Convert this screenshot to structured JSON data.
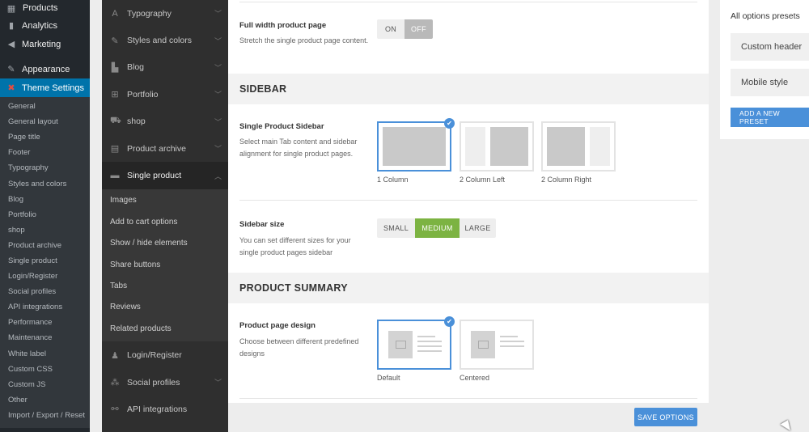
{
  "wp_admin": {
    "top_item": "Products",
    "menu": [
      {
        "label": "Analytics",
        "icon": "bar-chart-icon"
      },
      {
        "label": "Marketing",
        "icon": "megaphone-icon"
      },
      {
        "label": "Appearance",
        "icon": "paintbrush-icon"
      },
      {
        "label": "Theme Settings",
        "icon": "theme-icon",
        "active": true
      }
    ],
    "submenu": [
      "General",
      "General layout",
      "Page title",
      "Footer",
      "Typography",
      "Styles and colors",
      "Blog",
      "Portfolio",
      "shop",
      "Product archive",
      "Single product",
      "Login/Register",
      "Social profiles",
      "API integrations",
      "Performance",
      "Maintenance",
      "White label",
      "Custom CSS",
      "Custom JS",
      "Other",
      "Import / Export / Reset"
    ]
  },
  "options_nav": {
    "items_before": [
      {
        "label": "Typography",
        "icon": "typography-icon"
      },
      {
        "label": "Styles and colors",
        "icon": "pencil-icon"
      },
      {
        "label": "Blog",
        "icon": "blog-icon"
      },
      {
        "label": "Portfolio",
        "icon": "grid-icon"
      },
      {
        "label": "shop",
        "icon": "cart-icon"
      },
      {
        "label": "Product archive",
        "icon": "archive-icon"
      }
    ],
    "active": {
      "label": "Single product",
      "icon": "box-icon"
    },
    "sub_items": [
      "Images",
      "Add to cart options",
      "Show / hide elements",
      "Share buttons",
      "Tabs",
      "Reviews",
      "Related products"
    ],
    "items_after": [
      {
        "label": "Login/Register",
        "icon": "user-icon"
      },
      {
        "label": "Social profiles",
        "icon": "share-icon"
      },
      {
        "label": "API integrations",
        "icon": "plug-icon"
      }
    ]
  },
  "main": {
    "full_width": {
      "title": "Full width product page",
      "desc": "Stretch the single product page content.",
      "on": "ON",
      "off": "OFF"
    },
    "sidebar_section": "SIDEBAR",
    "single_sidebar": {
      "title": "Single Product Sidebar",
      "desc": "Select main Tab content and sidebar alignment for single product pages.",
      "options": [
        "1 Column",
        "2 Column Left",
        "2 Column Right"
      ],
      "selected": "1 Column"
    },
    "sidebar_size": {
      "title": "Sidebar size",
      "desc": "You can set different sizes for your single product pages sidebar",
      "options": [
        "SMALL",
        "MEDIUM",
        "LARGE"
      ],
      "selected": "MEDIUM"
    },
    "summary_section": "PRODUCT SUMMARY",
    "page_design": {
      "title": "Product page design",
      "desc": "Choose between different predefined designs",
      "options": [
        "Default",
        "Centered"
      ],
      "selected": "Default"
    },
    "save_label": "SAVE OPTIONS"
  },
  "presets": {
    "title": "All options presets",
    "items": [
      "Custom header",
      "Mobile style"
    ],
    "add_label": "ADD A NEW PRESET"
  },
  "colors": {
    "accent": "#4a90d9",
    "green": "#7cb342",
    "wp_sidebar": "#23282d",
    "wp_active": "#0073aa"
  }
}
